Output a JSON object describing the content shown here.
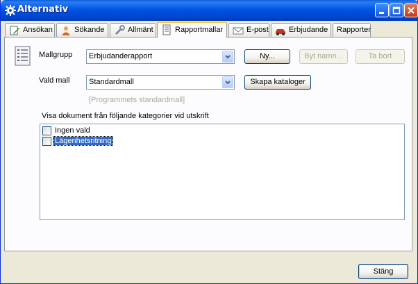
{
  "window": {
    "title": "Alternativ"
  },
  "tabs": [
    {
      "label": "Ansökan",
      "icon": "edit-icon",
      "active": false
    },
    {
      "label": "Sökande",
      "icon": "person-icon",
      "active": false
    },
    {
      "label": "Allmänt",
      "icon": "tools-icon",
      "active": false
    },
    {
      "label": "Rapportmallar",
      "icon": "document-icon",
      "active": true
    },
    {
      "label": "E-post",
      "icon": "envelope-icon",
      "active": false
    },
    {
      "label": "Erbjudande",
      "icon": "car-icon",
      "active": false
    },
    {
      "label": "Rapporter",
      "icon": "",
      "active": false
    }
  ],
  "form": {
    "mallgrupp_label": "Mallgrupp",
    "mallgrupp_value": "Erbjudanderapport",
    "vald_mall_label": "Vald mall",
    "vald_mall_value": "Standardmall",
    "program_default_text": "[Programmets standardmall]",
    "buttons": {
      "new": "Ny...",
      "rename": "Byt namn...",
      "delete": "Ta bort",
      "create_catalogs": "Skapa kataloger"
    }
  },
  "categories": {
    "heading": "Visa dokument från följande kategorier vid utskrift",
    "items": [
      {
        "label": "Ingen vald",
        "checked": false,
        "selected": false
      },
      {
        "label": "Lägenhetsritning",
        "checked": false,
        "selected": true
      }
    ]
  },
  "footer": {
    "close_label": "Stäng"
  },
  "colors": {
    "title_bar": "#0055e5",
    "selection": "#316ac5",
    "tab_highlight": "#ffc83c"
  }
}
